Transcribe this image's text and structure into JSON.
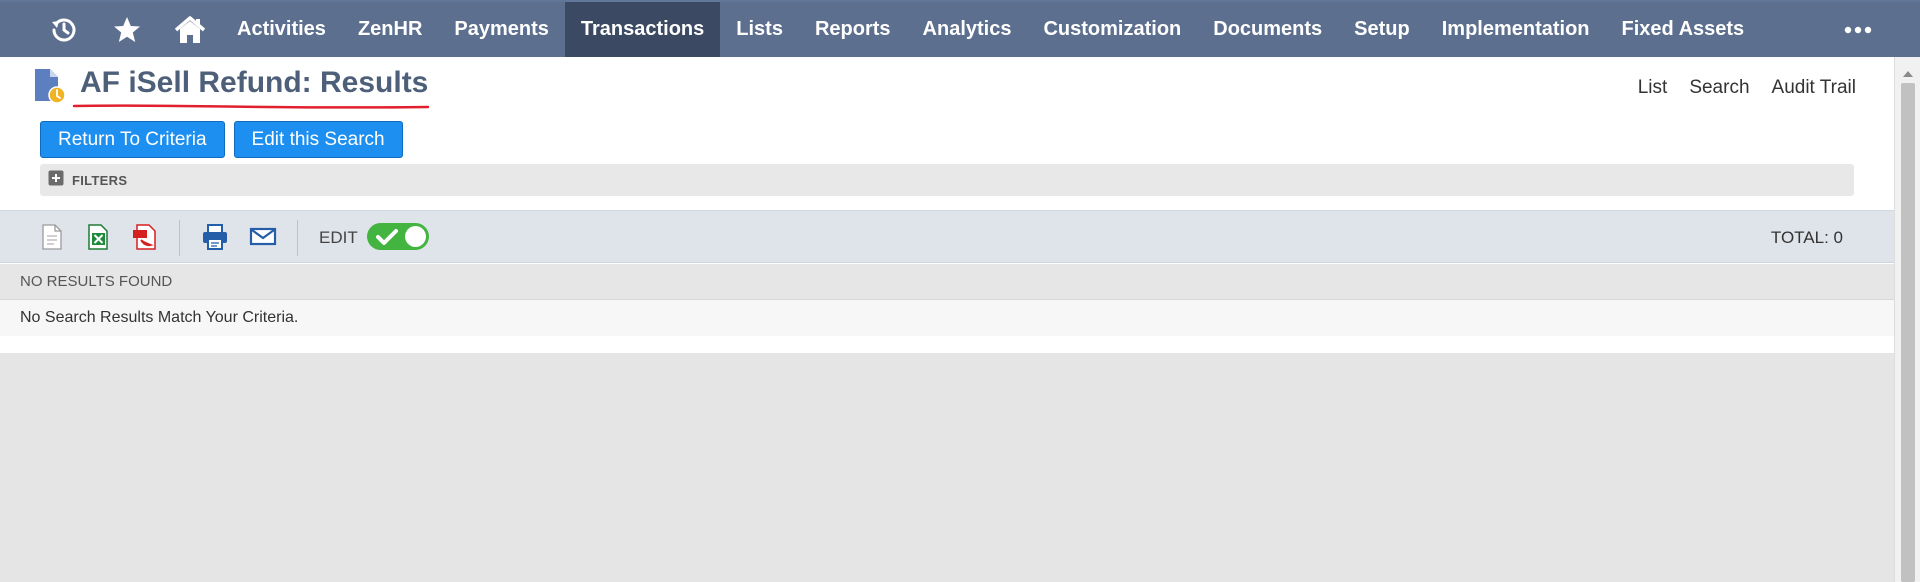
{
  "nav": {
    "icons": [
      "recent-history-icon",
      "star-icon",
      "home-icon"
    ],
    "items": [
      {
        "label": "Activities"
      },
      {
        "label": "ZenHR"
      },
      {
        "label": "Payments"
      },
      {
        "label": "Transactions",
        "active": true
      },
      {
        "label": "Lists"
      },
      {
        "label": "Reports"
      },
      {
        "label": "Analytics"
      },
      {
        "label": "Customization"
      },
      {
        "label": "Documents"
      },
      {
        "label": "Setup"
      },
      {
        "label": "Implementation"
      },
      {
        "label": "Fixed Assets"
      }
    ],
    "more_icon": "more-dots-icon"
  },
  "page": {
    "title": "AF iSell Refund: Results",
    "links": [
      "List",
      "Search",
      "Audit Trail"
    ],
    "buttons": {
      "return_to_criteria": "Return To Criteria",
      "edit_search": "Edit this Search"
    },
    "filters_label": "FILTERS"
  },
  "toolbar": {
    "icons": [
      "export-csv-icon",
      "export-excel-icon",
      "export-pdf-icon",
      "print-icon",
      "email-icon"
    ],
    "edit_label": "EDIT",
    "edit_toggle_on": true,
    "total_label": "TOTAL: 0"
  },
  "results": {
    "header": "NO RESULTS FOUND",
    "message": "No Search Results Match Your Criteria."
  },
  "colors": {
    "nav_bg": "#5d6f8e",
    "nav_active": "#3b4a62",
    "button_blue": "#1c8ff0",
    "toggle_green": "#42b43f",
    "title_color": "#4d5f79",
    "underline_red": "#e0202e"
  }
}
